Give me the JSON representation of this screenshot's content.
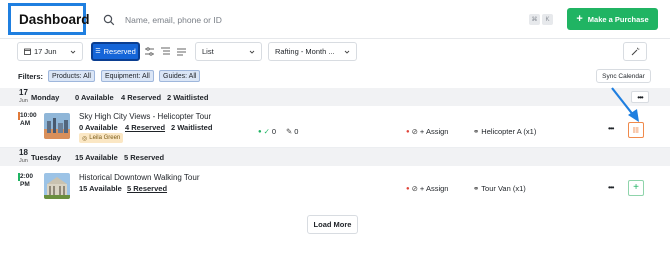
{
  "header": {
    "title": "Dashboard",
    "search_placeholder": "Name, email, phone or ID",
    "shortcut_keys": [
      "⌘",
      "K"
    ],
    "purchase_label": "Make a Purchase"
  },
  "toolbar": {
    "date_label": "17 Jun",
    "view_mode_label": "Reserved",
    "layout_label": "List",
    "filter_label": "Rafting - Month ..."
  },
  "filters": {
    "label": "Filters:",
    "chips": [
      "Products: All",
      "Equipment: All",
      "Guides: All"
    ],
    "sync_label": "Sync Calendar"
  },
  "days": [
    {
      "day_num": "17",
      "month": "Jun",
      "day_name": "Monday",
      "stats": [
        "0 Available",
        "4 Reserved",
        "2 Waitlisted"
      ],
      "tours": [
        {
          "time": "10:00",
          "ampm": "AM",
          "name": "Sky High City Views - Helicopter Tour",
          "available": "0 Available",
          "reserved": "4 Reserved",
          "waitlisted": "2 Waitlisted",
          "guide": "Leila Green",
          "checked_in": "0",
          "edited": "0",
          "assign_label": "+ Assign",
          "resource": "Helicopter A (x1)"
        }
      ]
    },
    {
      "day_num": "18",
      "month": "Jun",
      "day_name": "Tuesday",
      "stats": [
        "15 Available",
        "5 Reserved"
      ],
      "tours": [
        {
          "time": "2:00",
          "ampm": "PM",
          "name": "Historical Downtown Walking Tour",
          "available": "15 Available",
          "reserved": "5 Reserved",
          "assign_label": "+ Assign",
          "resource": "Tour Van (x1)"
        }
      ]
    }
  ],
  "load_more_label": "Load More",
  "colors": {
    "accent_blue": "#1565d8",
    "highlight_blue": "#1f7fe0",
    "purchase_green": "#20b463",
    "warn_orange": "#f08a4b"
  }
}
